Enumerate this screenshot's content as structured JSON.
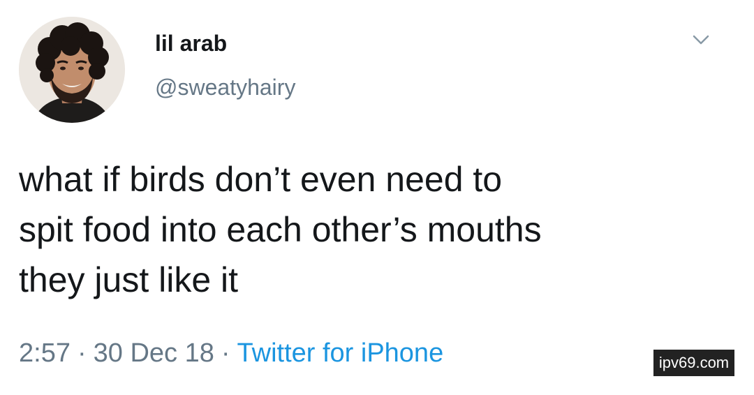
{
  "tweet": {
    "author": {
      "display_name": "lil arab",
      "handle": "@sweatyhairy"
    },
    "text_lines": [
      "what if birds don’t even need to",
      "spit food into each other’s mouths",
      "they just like it"
    ],
    "meta": {
      "time": "2:57",
      "date": "30 Dec 18",
      "separator": "·",
      "source": "Twitter for iPhone"
    },
    "menu_icon": "chevron-down-icon"
  },
  "watermark": {
    "text": "ipv69.com"
  },
  "colors": {
    "text_primary": "#14171a",
    "text_secondary": "#657786",
    "link": "#1b95e0",
    "background": "#ffffff",
    "watermark_bg": "#222222"
  }
}
